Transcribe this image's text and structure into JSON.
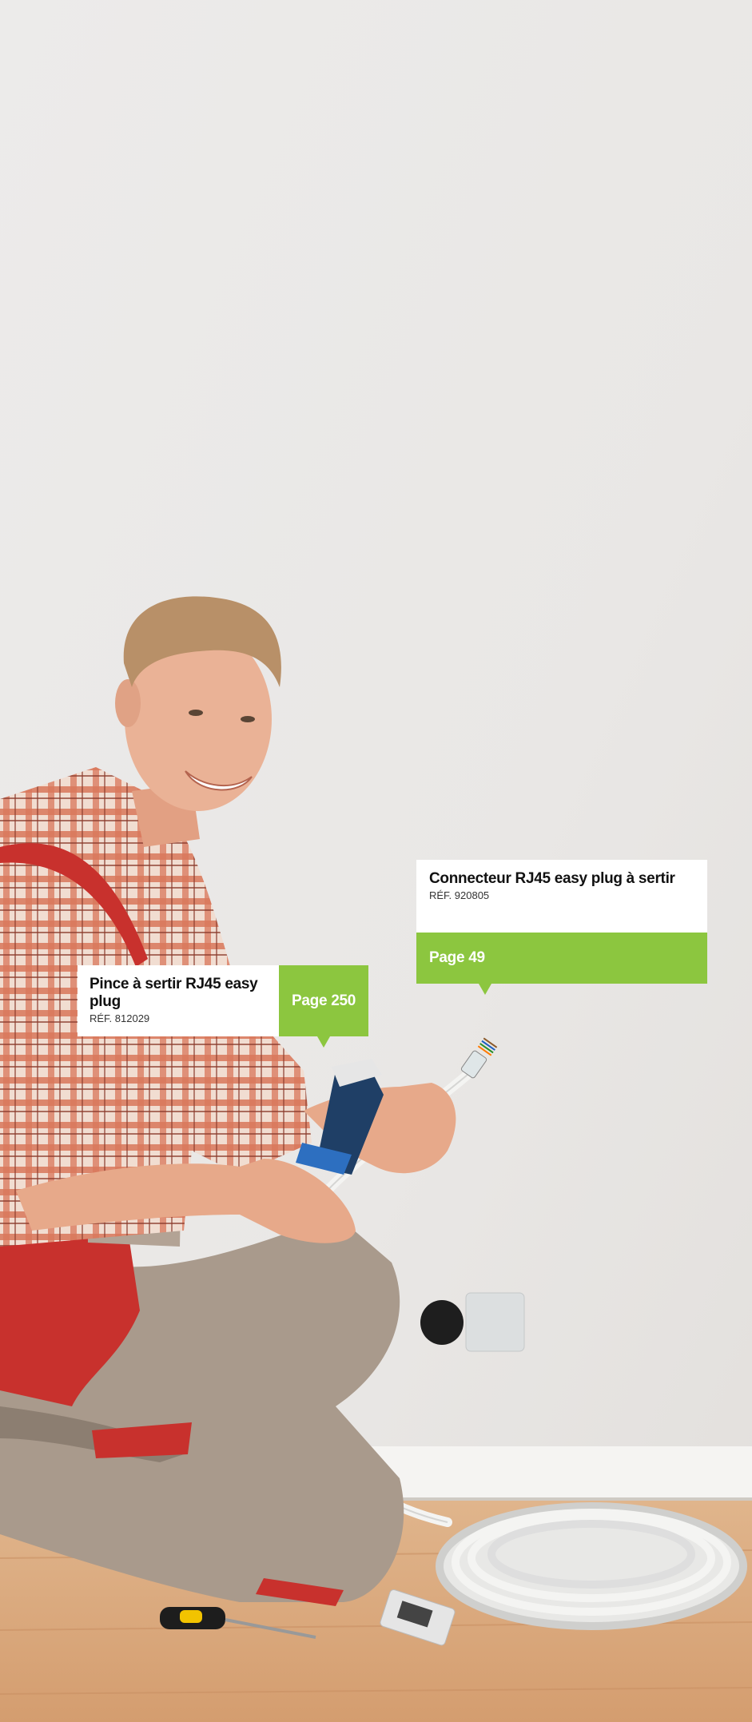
{
  "callouts": [
    {
      "product": "Pince à sertir RJ45 easy plug",
      "reference": "RÉF. 812029",
      "page": "Page 250"
    },
    {
      "product": "Connecteur RJ45 easy plug à sertir",
      "reference": "RÉF. 920805",
      "page": "Page 49"
    }
  ],
  "colors": {
    "accent": "#8cc63f",
    "wall": "#ecebea",
    "floor": "#d8a57a"
  }
}
